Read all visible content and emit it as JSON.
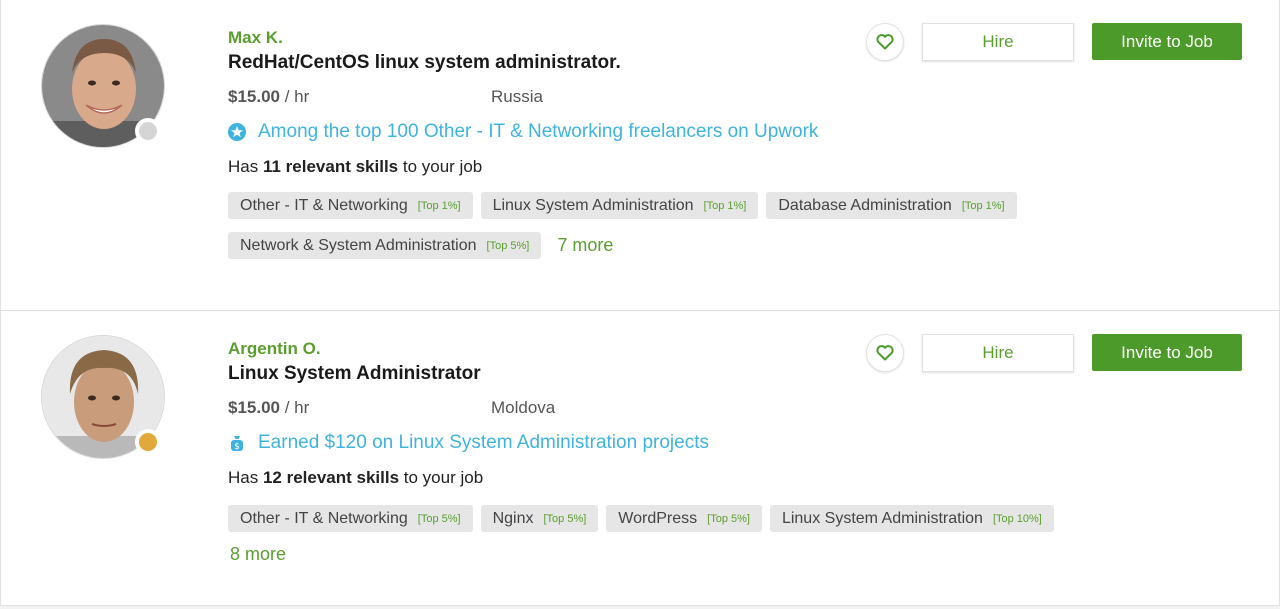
{
  "colors": {
    "accent_green": "#5a9e2e",
    "button_green": "#4c9b2a",
    "badge_blue": "#3fb3e0"
  },
  "actions": {
    "hire_label": "Hire",
    "invite_label": "Invite to Job"
  },
  "freelancers": [
    {
      "name": "Max K.",
      "title": "RedHat/CentOS linux system administrator.",
      "rate": "$15.00",
      "rate_unit": "/ hr",
      "location": "Russia",
      "status_color": "#d5d5d5",
      "badge_icon": "star-badge-icon",
      "badge_text": "Among the top 100 Other - IT & Networking freelancers on Upwork",
      "skills_prefix": "Has ",
      "skills_count": "11 relevant skills",
      "skills_suffix": " to your job",
      "tags_row1": [
        {
          "name": "Other - IT & Networking",
          "rank": "[Top 1%]"
        },
        {
          "name": "Linux System Administration",
          "rank": "[Top 1%]"
        },
        {
          "name": "Database Administration",
          "rank": "[Top 1%]"
        }
      ],
      "tags_row2": [
        {
          "name": "Network & System Administration",
          "rank": "[Top 5%]"
        }
      ],
      "more_label": "7 more"
    },
    {
      "name": "Argentin O.",
      "title": "Linux System Administrator",
      "rate": "$15.00",
      "rate_unit": "/ hr",
      "location": "Moldova",
      "status_color": "#e3a83a",
      "badge_icon": "money-bag-icon",
      "badge_text": "Earned $120 on Linux System Administration projects",
      "skills_prefix": "Has ",
      "skills_count": "12 relevant skills",
      "skills_suffix": " to your job",
      "tags_row1": [
        {
          "name": "Other - IT & Networking",
          "rank": "[Top 5%]"
        },
        {
          "name": "Nginx",
          "rank": "[Top 5%]"
        },
        {
          "name": "WordPress",
          "rank": "[Top 5%]"
        },
        {
          "name": "Linux System Administration",
          "rank": "[Top 10%]"
        }
      ],
      "more_label": "8 more"
    }
  ]
}
